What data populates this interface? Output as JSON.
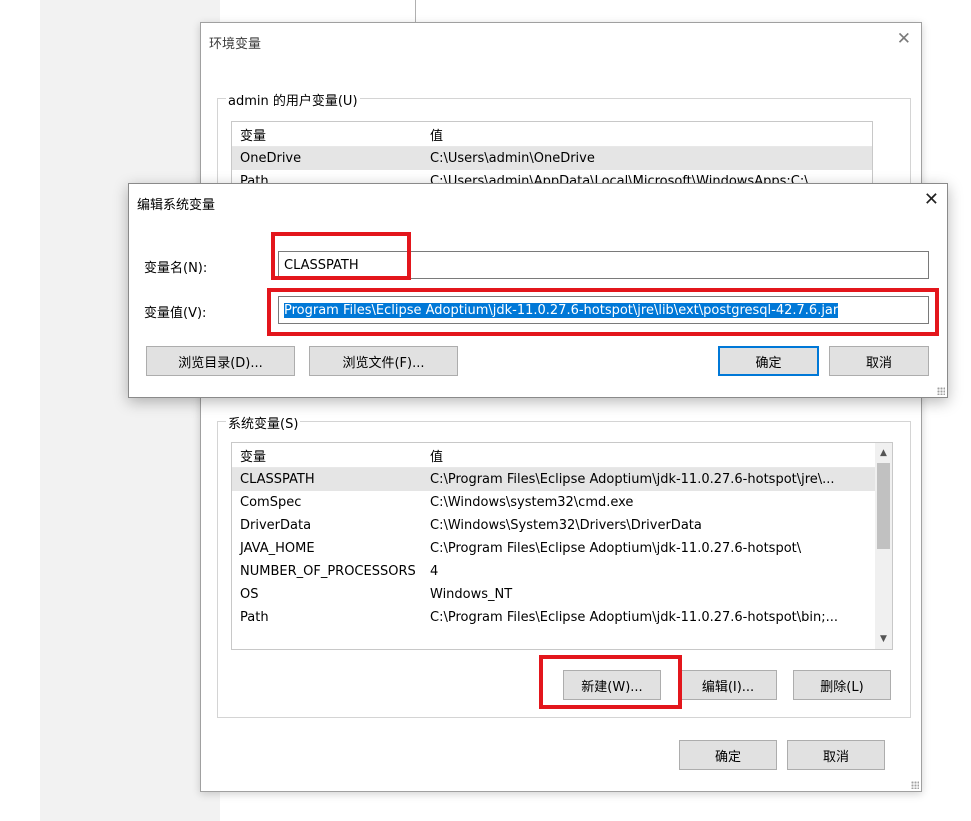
{
  "env_window": {
    "title": "环境变量",
    "user_group_label": "admin 的用户变量(U)",
    "user_columns": [
      "变量",
      "值"
    ],
    "user_rows": [
      {
        "name": "OneDrive",
        "value": "C:\\Users\\admin\\OneDrive"
      },
      {
        "name": "Path",
        "value": "C:\\Users\\admin\\AppData\\Local\\Microsoft\\WindowsApps;C:\\..."
      }
    ],
    "system_group_label": "系统变量(S)",
    "system_columns": [
      "变量",
      "值"
    ],
    "system_rows": [
      {
        "name": "CLASSPATH",
        "value": "C:\\Program Files\\Eclipse Adoptium\\jdk-11.0.27.6-hotspot\\jre\\..."
      },
      {
        "name": "ComSpec",
        "value": "C:\\Windows\\system32\\cmd.exe"
      },
      {
        "name": "DriverData",
        "value": "C:\\Windows\\System32\\Drivers\\DriverData"
      },
      {
        "name": "JAVA_HOME",
        "value": "C:\\Program Files\\Eclipse Adoptium\\jdk-11.0.27.6-hotspot\\"
      },
      {
        "name": "NUMBER_OF_PROCESSORS",
        "value": "4"
      },
      {
        "name": "OS",
        "value": "Windows_NT"
      },
      {
        "name": "Path",
        "value": "C:\\Program Files\\Eclipse Adoptium\\jdk-11.0.27.6-hotspot\\bin;..."
      }
    ],
    "new_label": "新建(W)...",
    "edit_label": "编辑(I)...",
    "delete_label": "删除(L)",
    "ok_label": "确定",
    "cancel_label": "取消"
  },
  "edit_dialog": {
    "title": "编辑系统变量",
    "name_label": "变量名(N):",
    "name_value": "CLASSPATH",
    "value_label": "变量值(V):",
    "value_value": "Program Files\\Eclipse Adoptium\\jdk-11.0.27.6-hotspot\\jre\\lib\\ext\\postgresql-42.7.6.jar",
    "browse_dir_label": "浏览目录(D)...",
    "browse_file_label": "浏览文件(F)...",
    "ok_label": "确定",
    "cancel_label": "取消"
  },
  "colors": {
    "highlight": "#e3161c",
    "selection": "#0078d7",
    "button_face": "#e1e1e1"
  },
  "icons": {
    "close": "close-icon",
    "scroll_up": "chevron-up-icon",
    "scroll_down": "chevron-down-icon"
  }
}
